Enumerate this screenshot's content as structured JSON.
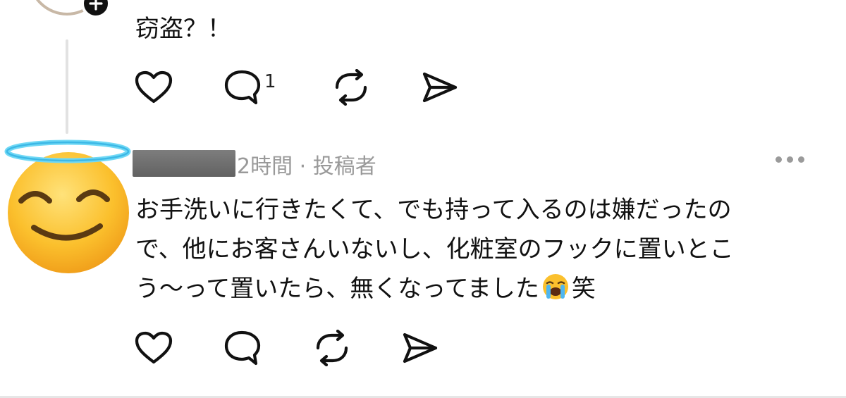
{
  "previous_post": {
    "text": "窃盗？！",
    "reply_count": "1",
    "icons": [
      "heart-icon",
      "comment-icon",
      "repost-icon",
      "share-icon"
    ]
  },
  "reply": {
    "meta": "2時間 · 投稿者",
    "lines": [
      "お手洗いに行きたくて、でも持って入るのは嫌だったの",
      "で、他にお客さんいないし、化粧室のフックに置いとこ",
      "う〜って置いたら、無くなってました"
    ],
    "emoji": "loudly-crying-face",
    "suffix": "笑",
    "avatar": "smiling-face-with-halo",
    "icons": [
      "heart-icon",
      "comment-icon",
      "repost-icon",
      "share-icon"
    ]
  },
  "colors": {
    "text": "#111111",
    "meta": "#999999",
    "divider": "#e2e2e2"
  }
}
